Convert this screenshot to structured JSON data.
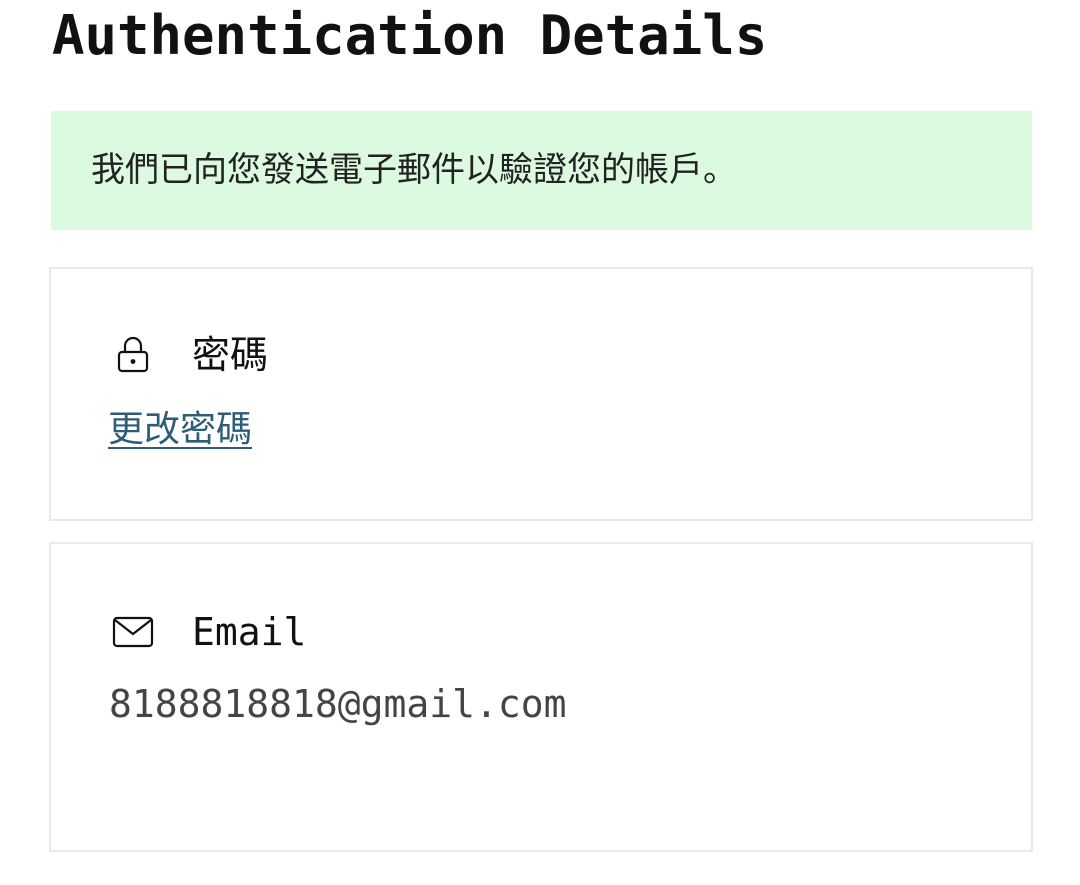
{
  "page": {
    "title": "Authentication Details"
  },
  "alert": {
    "message": "我們已向您發送電子郵件以驗證您的帳戶。",
    "background": "#dcfadf"
  },
  "password_card": {
    "icon": "lock-icon",
    "label": "密碼",
    "link_label": "更改密碼",
    "link_color": "#2e5d78"
  },
  "email_card": {
    "icon": "mail-icon",
    "label": "Email",
    "value": "8188818818@gmail.com"
  }
}
